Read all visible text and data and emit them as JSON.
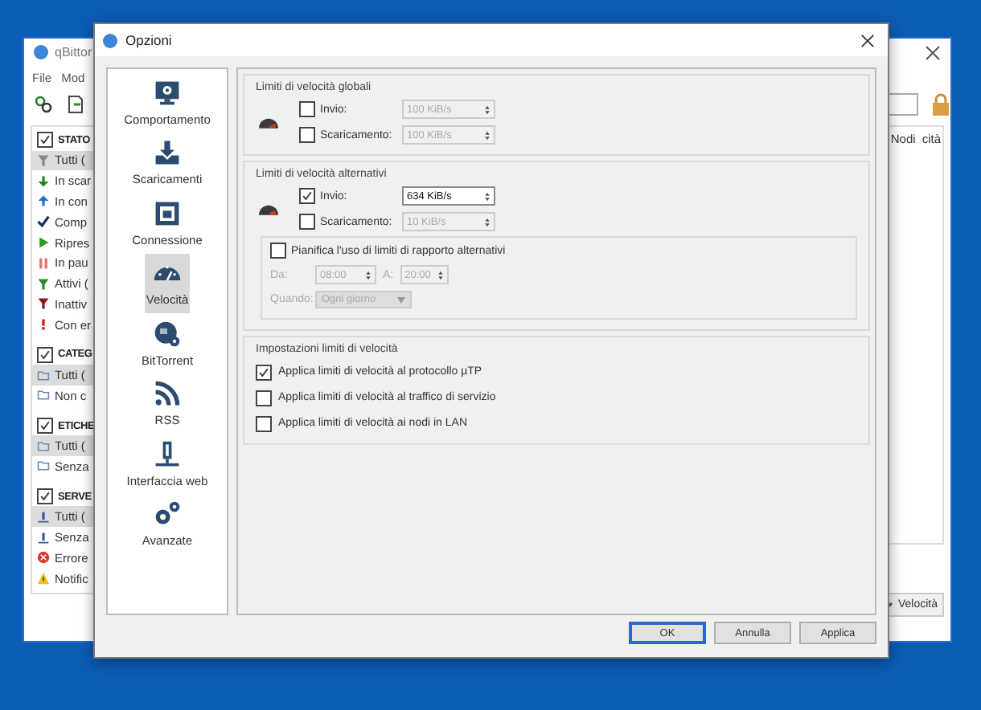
{
  "background_window": {
    "title": "qBittor",
    "menu": [
      "File",
      "Mod"
    ],
    "sidebar": [
      {
        "heading": "STATO",
        "checked": true,
        "items": [
          {
            "label": "Tutti (",
            "selected": true,
            "kind": "filter-grey"
          },
          {
            "label": "In scar",
            "selected": false,
            "kind": "arrow-down"
          },
          {
            "label": "In con",
            "selected": false,
            "kind": "arrow-up"
          },
          {
            "label": "Comp",
            "selected": false,
            "kind": "check"
          },
          {
            "label": "Ripres",
            "selected": false,
            "kind": "play"
          },
          {
            "label": "In pau",
            "selected": false,
            "kind": "pause"
          },
          {
            "label": "Attivi (",
            "selected": false,
            "kind": "filter-green"
          },
          {
            "label": "Inattiv",
            "selected": false,
            "kind": "filter-red"
          },
          {
            "label": "Con er",
            "selected": false,
            "kind": "exclamation"
          }
        ]
      },
      {
        "heading": "CATEG",
        "checked": true,
        "items": [
          {
            "label": "Tutti (",
            "selected": true,
            "kind": "folder"
          },
          {
            "label": "Non c",
            "selected": false,
            "kind": "folder"
          }
        ]
      },
      {
        "heading": "ETICHE",
        "checked": true,
        "items": [
          {
            "label": "Tutti (",
            "selected": true,
            "kind": "folder"
          },
          {
            "label": "Senza",
            "selected": false,
            "kind": "folder"
          }
        ]
      },
      {
        "heading": "SERVE",
        "checked": true,
        "items": [
          {
            "label": "Tutti (",
            "selected": true,
            "kind": "server"
          },
          {
            "label": "Senza",
            "selected": false,
            "kind": "server"
          },
          {
            "label": "Errore",
            "selected": false,
            "kind": "error"
          },
          {
            "label": "Notific",
            "selected": false,
            "kind": "warning"
          }
        ]
      }
    ],
    "columns": [
      "Nodi",
      "cità"
    ],
    "status_button": "Velocità"
  },
  "dialog": {
    "title": "Opzioni",
    "categories": [
      {
        "label": "Comportamento",
        "selected": false,
        "kind": "monitor"
      },
      {
        "label": "Scaricamenti",
        "selected": false,
        "kind": "download"
      },
      {
        "label": "Connessione",
        "selected": false,
        "kind": "port"
      },
      {
        "label": "Velocità",
        "selected": true,
        "kind": "gauge"
      },
      {
        "label": "BitTorrent",
        "selected": false,
        "kind": "globe"
      },
      {
        "label": "RSS",
        "selected": false,
        "kind": "rss"
      },
      {
        "label": "Interfaccia web",
        "selected": false,
        "kind": "plug"
      },
      {
        "label": "Avanzate",
        "selected": false,
        "kind": "gears"
      }
    ],
    "global_limits": {
      "title": "Limiti di velocità globali",
      "rows": [
        {
          "label": "Invio:",
          "checked": false,
          "value": "100 KiB/s"
        },
        {
          "label": "Scaricamento:",
          "checked": false,
          "value": "100 KiB/s"
        }
      ]
    },
    "alternative_limits": {
      "title": "Limiti di velocità alternativi",
      "rows": [
        {
          "label": "Invio:",
          "checked": true,
          "value": "634 KiB/s"
        },
        {
          "label": "Scaricamento:",
          "checked": false,
          "value": "10 KiB/s"
        }
      ],
      "schedule": {
        "label": "Pianifica l'uso di limiti di rapporto alternativi",
        "checked": false,
        "from_label": "Da:",
        "from": "08:00",
        "to_label": "A:",
        "to": "20:00",
        "when_label": "Quando:",
        "when": "Ogni giorno"
      }
    },
    "limit_settings": {
      "title": "Impostazioni limiti di velocità",
      "options": [
        {
          "label": "Applica limiti di velocità al protocollo µTP",
          "checked": true
        },
        {
          "label": "Applica limiti di velocità al traffico di servizio",
          "checked": false
        },
        {
          "label": "Applica limiti di velocità ai nodi in LAN",
          "checked": false
        }
      ]
    },
    "buttons": [
      {
        "label": "OK",
        "default": true
      },
      {
        "label": "Annulla",
        "default": false
      },
      {
        "label": "Applica",
        "default": false
      }
    ]
  }
}
